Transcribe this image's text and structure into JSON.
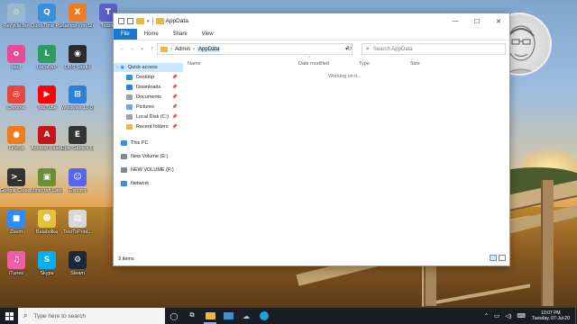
{
  "desktop": {
    "icons": [
      {
        "label": "Recycle Bin",
        "color": "#9ab7cf",
        "glyph": "♲"
      },
      {
        "label": "QuickTime Player",
        "color": "#3b8fd6",
        "glyph": "Q"
      },
      {
        "label": "Xampp con Shortcut",
        "color": "#f07b22",
        "glyph": "X"
      },
      {
        "label": "Teams",
        "color": "#5b5fc7",
        "glyph": "T"
      },
      {
        "label": "osu!",
        "color": "#e64c93",
        "glyph": "o"
      },
      {
        "label": "LocalWP",
        "color": "#2f9b62",
        "glyph": "L"
      },
      {
        "label": "OBS Studio",
        "color": "#2b2b2b",
        "glyph": "◉"
      },
      {
        "label": "Chrome",
        "color": "#e8453c",
        "glyph": "◎"
      },
      {
        "label": "YouTube",
        "color": "#ff0000",
        "glyph": "▶"
      },
      {
        "label": "Windows 10 Update Ass...",
        "color": "#2f7fd8",
        "glyph": "⊞"
      },
      {
        "label": "Firefox",
        "color": "#f07a1d",
        "glyph": "●"
      },
      {
        "label": "Acrobat Reader DC",
        "color": "#c4151c",
        "glyph": "A"
      },
      {
        "label": "Epic Games Launcher",
        "color": "#333333",
        "glyph": "E"
      },
      {
        "label": "Google Cloud S...",
        "color": "#333333",
        "glyph": ">_"
      },
      {
        "label": "Minecraft Launcher",
        "color": "#6b8e3a",
        "glyph": "▣"
      },
      {
        "label": "Discord",
        "color": "#5865f2",
        "glyph": "☺"
      },
      {
        "label": "Zoom",
        "color": "#2d8cff",
        "glyph": "■"
      },
      {
        "label": "Balabolka",
        "color": "#e2c23a",
        "glyph": "☻"
      },
      {
        "label": "TextToPrint...",
        "color": "#d8d8d8",
        "glyph": "▤"
      },
      {
        "label": "iTunes",
        "color": "#ef5fa7",
        "glyph": "♫"
      },
      {
        "label": "Skype",
        "color": "#00aff0",
        "glyph": "S"
      },
      {
        "label": "Steam",
        "color": "#1b2838",
        "glyph": "⚙"
      }
    ]
  },
  "explorer": {
    "title": "AppData",
    "ribbon_tabs": [
      "File",
      "Home",
      "Share",
      "View"
    ],
    "window_controls": {
      "minimize": "—",
      "maximize": "☐",
      "close": "✕"
    },
    "breadcrumb": {
      "parent": "Admin",
      "current": "AppData"
    },
    "search_placeholder": "Search AppData",
    "nav_items": [
      {
        "label": "Quick access",
        "pinned": false
      },
      {
        "label": "Desktop",
        "pinned": true
      },
      {
        "label": "Downloads",
        "pinned": true
      },
      {
        "label": "Documents",
        "pinned": true
      },
      {
        "label": "Pictures",
        "pinned": true
      },
      {
        "label": "Local Disk (C:)",
        "pinned": true
      },
      {
        "label": "Recent folders",
        "pinned": true
      },
      {
        "label": "This PC",
        "pinned": false
      },
      {
        "label": "New Volume (E:)",
        "pinned": false
      },
      {
        "label": "NEW VOLUME (F:)",
        "pinned": false
      },
      {
        "label": "Network",
        "pinned": false
      }
    ],
    "columns": [
      "Name",
      "Date modified",
      "Type",
      "Size"
    ],
    "status_message": "Working on it...",
    "item_count": "3 items"
  },
  "taskbar": {
    "search_placeholder": "Type here to search",
    "time": "10:07 PM",
    "date": "Tuesday, 07-Jul-20"
  },
  "colors": {
    "accent": "#1979ca",
    "taskbar": "#1a1e24",
    "selection": "#cce8ff"
  }
}
